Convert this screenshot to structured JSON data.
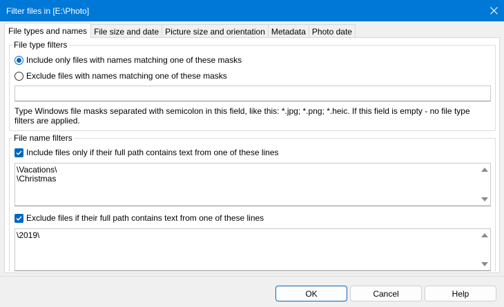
{
  "window": {
    "title": "Filter files in [E:\\Photo]"
  },
  "tabs": [
    {
      "label": "File types and names",
      "active": true
    },
    {
      "label": "File size and date"
    },
    {
      "label": "Picture size and orientation"
    },
    {
      "label": "Metadata"
    },
    {
      "label": "Photo date"
    }
  ],
  "file_type_filters": {
    "legend": "File type filters",
    "include_label": "Include only files with names matching one of these masks",
    "exclude_label": "Exclude files with names matching one of these masks",
    "selected": "include",
    "masks_value": "",
    "hint": "Type Windows file masks separated with semicolon in this field, like this: *.jpg; *.png; *.heic. If this field is empty - no file type filters are applied."
  },
  "file_name_filters": {
    "legend": "File name filters",
    "include_label": "Include files only if their full path contains text from one of these lines",
    "include_checked": true,
    "include_text": "\\Vacations\\\n\\Christmas",
    "exclude_label": "Exclude files if their full path contains text from one of these lines",
    "exclude_checked": true,
    "exclude_text": "\\2019\\"
  },
  "buttons": {
    "ok": "OK",
    "cancel": "Cancel",
    "help": "Help"
  },
  "colors": {
    "titlebar": "#0078d7",
    "accent": "#0067c0"
  },
  "icons": {
    "close": "close-icon",
    "check": "checkmark-icon"
  }
}
